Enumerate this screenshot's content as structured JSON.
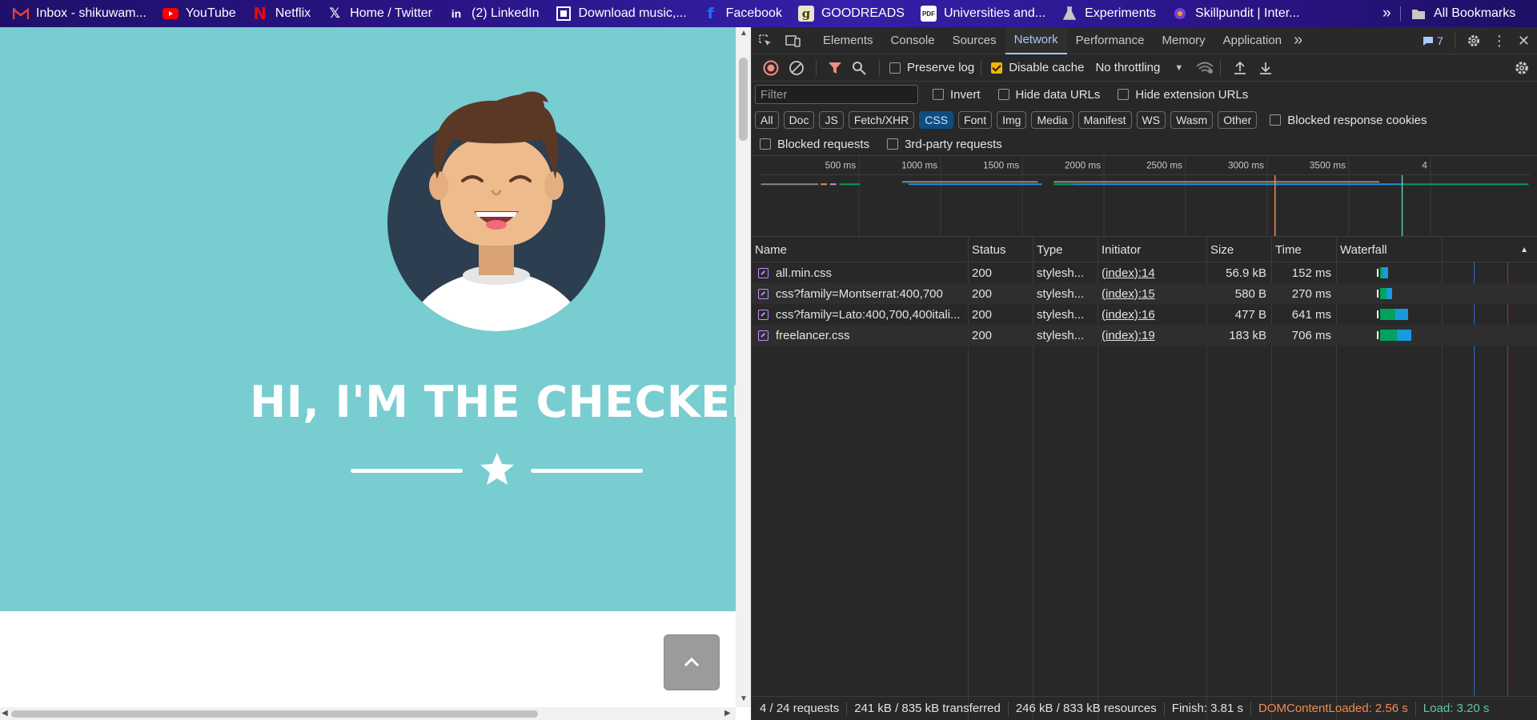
{
  "bookmarks": [
    {
      "label": "Inbox - shikuwam...",
      "icon": "gmail-icon",
      "color": "#ea4335"
    },
    {
      "label": "YouTube",
      "icon": "youtube-icon",
      "color": "#ff0000"
    },
    {
      "label": "Netflix",
      "icon": "netflix-icon",
      "color": "#e50914"
    },
    {
      "label": "Home / Twitter",
      "icon": "x-icon",
      "color": "#ffffff"
    },
    {
      "label": "(2) LinkedIn",
      "icon": "linkedin-icon",
      "color": "#0a66c2"
    },
    {
      "label": "Download music,...",
      "icon": "music-icon",
      "color": "#ffffff"
    },
    {
      "label": "Facebook",
      "icon": "facebook-icon",
      "color": "#1877f2"
    },
    {
      "label": "GOODREADS",
      "icon": "goodreads-icon",
      "color": "#e9e5cd"
    },
    {
      "label": "Universities and...",
      "icon": "pdf-icon",
      "color": "#ffffff"
    },
    {
      "label": "Experiments",
      "icon": "flask-icon",
      "color": "#c7c7c7"
    },
    {
      "label": "Skillpundit | Inter...",
      "icon": "skillpundit-icon",
      "color": "#f0a030"
    }
  ],
  "bookmarks_overflow": "»",
  "all_bookmarks": "All Bookmarks",
  "page": {
    "hero_title": "HI, I'M THE CHECKER!",
    "scroll_top_icon": "chevron-up-icon",
    "colors": {
      "hero_bg": "#78cdd1",
      "text": "#ffffff",
      "button": "#9b9b9b"
    }
  },
  "devtools": {
    "tabs": [
      "Elements",
      "Console",
      "Sources",
      "Network",
      "Performance",
      "Memory",
      "Application"
    ],
    "active_tab": "Network",
    "issues_count": "7",
    "toolbar": {
      "preserve_log": "Preserve log",
      "disable_cache": "Disable cache",
      "throttling": "No throttling"
    },
    "filter": {
      "placeholder": "Filter",
      "invert": "Invert",
      "hide_data_urls": "Hide data URLs",
      "hide_extension_urls": "Hide extension URLs"
    },
    "types": [
      "All",
      "Doc",
      "JS",
      "Fetch/XHR",
      "CSS",
      "Font",
      "Img",
      "Media",
      "Manifest",
      "WS",
      "Wasm",
      "Other"
    ],
    "active_type": "CSS",
    "blocked_response_cookies": "Blocked response cookies",
    "blocked_requests": "Blocked requests",
    "third_party_requests": "3rd-party requests",
    "timeline_ticks": [
      "500 ms",
      "1000 ms",
      "1500 ms",
      "2000 ms",
      "2500 ms",
      "3000 ms",
      "3500 ms",
      "4"
    ],
    "columns": [
      "Name",
      "Status",
      "Type",
      "Initiator",
      "Size",
      "Time",
      "Waterfall"
    ],
    "requests": [
      {
        "name": "all.min.css",
        "status": "200",
        "type": "stylesh...",
        "initiator": "(index):14",
        "size": "56.9 kB",
        "time": "152 ms"
      },
      {
        "name": "css?family=Montserrat:400,700",
        "status": "200",
        "type": "stylesh...",
        "initiator": "(index):15",
        "size": "580 B",
        "time": "270 ms"
      },
      {
        "name": "css?family=Lato:400,700,400itali...",
        "status": "200",
        "type": "stylesh...",
        "initiator": "(index):16",
        "size": "477 B",
        "time": "641 ms"
      },
      {
        "name": "freelancer.css",
        "status": "200",
        "type": "stylesh...",
        "initiator": "(index):19",
        "size": "183 kB",
        "time": "706 ms"
      }
    ],
    "summary": {
      "requests": "4 / 24 requests",
      "transferred": "241 kB / 835 kB transferred",
      "resources": "246 kB / 833 kB resources",
      "finish": "Finish: 3.81 s",
      "dom_content_loaded": "DOMContentLoaded: 2.56 s",
      "load": "Load: 3.20 s"
    },
    "colors": {
      "dcl": "#f28b54",
      "load": "#5ec8b0",
      "accent": "#a8c7fa",
      "waiting": "#00a35c",
      "download": "#1a98e0"
    }
  }
}
